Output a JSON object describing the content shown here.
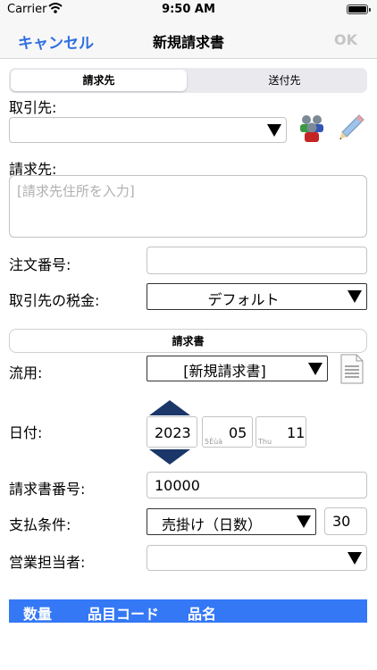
{
  "status_bar": {
    "carrier": "Carrier",
    "time": "9:50 AM"
  },
  "nav": {
    "cancel": "キャンセル",
    "title": "新規請求書",
    "ok": "OK"
  },
  "segment": {
    "active": "請求先",
    "inactive": "送付先"
  },
  "fields": {
    "customer_label": "取引先:",
    "bill_to_label": "請求先:",
    "bill_to_placeholder": "[請求先住所を入力]",
    "order_no_label": "注文番号:",
    "tax_label": "取引先の税金:",
    "tax_value": "デフォルト"
  },
  "invoice_section": {
    "title": "請求書"
  },
  "invoice": {
    "reuse_label": "流用:",
    "reuse_value": "[新規請求書]",
    "date_label": "日付:",
    "year": "2023",
    "month": "05",
    "month_sub": "5Èùà",
    "day": "11",
    "day_sub": "Thu",
    "invoice_no_label": "請求書番号:",
    "invoice_no": "10000",
    "terms_label": "支払条件:",
    "terms_value": "売掛け（日数）",
    "terms_days": "30",
    "sales_rep_label": "営業担当者:"
  },
  "table": {
    "columns": [
      "数量",
      "品目コード",
      "品名"
    ]
  },
  "colors": {
    "accent": "#2f6fe0",
    "header_bar": "#3478f6",
    "stepper": "#1b3769",
    "ok_disabled": "#c4c4c4"
  },
  "icons": [
    "wifi-icon",
    "battery-icon",
    "contacts-icon",
    "pencil-icon",
    "document-icon",
    "chevron-up-icon",
    "chevron-down-icon"
  ]
}
